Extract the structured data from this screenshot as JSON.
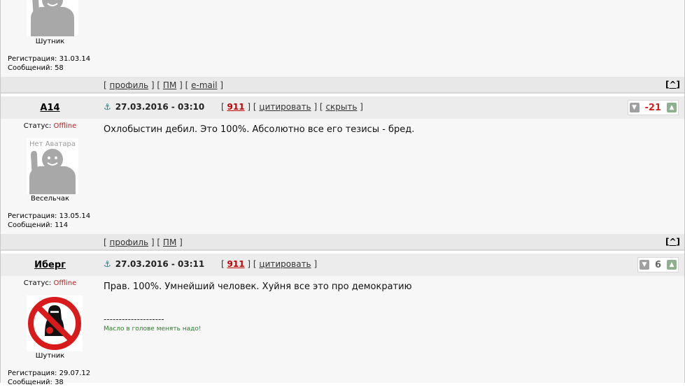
{
  "posts": [
    {
      "rank": "Шутник",
      "reg_label": "Регистрация:",
      "reg_date": "31.03.14",
      "msg_label": "Сообщений:",
      "msg_count": "58",
      "links": [
        "профиль",
        "ПМ",
        "e-mail"
      ],
      "up_label": "^"
    },
    {
      "author": "A14",
      "status_label": "Статус:",
      "status": "Offline",
      "no_avatar": "Нет Аватара",
      "rank": "Весельчак",
      "reg_label": "Регистрация:",
      "reg_date": "13.05.14",
      "msg_label": "Сообщений:",
      "msg_count": "114",
      "date": "27.03.2016 - 03:10",
      "num": "911",
      "actions": [
        "цитировать",
        "скрыть"
      ],
      "rating": "-21",
      "text": "Охлобыстин дебил. Это 100%. Абсолютно все его тезисы - бред.",
      "links": [
        "профиль",
        "ПМ"
      ],
      "up_label": "^"
    },
    {
      "author": "Иберг",
      "status_label": "Статус:",
      "status": "Offline",
      "rank": "Шутник",
      "reg_label": "Регистрация:",
      "reg_date": "29.07.12",
      "msg_label": "Сообщений:",
      "msg_count": "38",
      "date": "27.03.2016 - 03:11",
      "num": "911",
      "actions": [
        "цитировать"
      ],
      "rating": "6",
      "text": "Прав. 100%. Умнейший человек. Хуйня все это про демократию",
      "sig_line": "--------------------",
      "signature": "Масло в голове менять надо!"
    }
  ]
}
